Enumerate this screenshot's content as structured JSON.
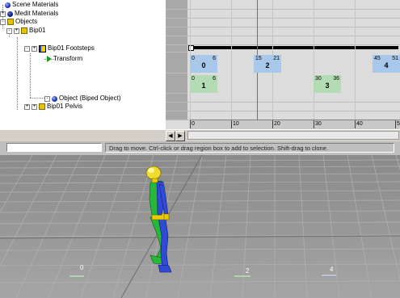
{
  "tree": {
    "items": [
      {
        "label": "Scene Materials"
      },
      {
        "label": "Medit Materials"
      },
      {
        "label": "Objects"
      },
      {
        "label": "Bip01"
      },
      {
        "label": "Bip01 Footsteps"
      },
      {
        "label": "Transform"
      },
      {
        "label": "Object (Biped Object)"
      },
      {
        "label": "Bip01 Pelvis"
      }
    ]
  },
  "footsteps": [
    {
      "start": "0",
      "end": "6",
      "number": "0",
      "color": "blue"
    },
    {
      "start": "15",
      "end": "21",
      "number": "2",
      "color": "blue"
    },
    {
      "start": "45",
      "end": "51",
      "number": "4",
      "color": "blue"
    },
    {
      "start": "0",
      "end": "6",
      "number": "1",
      "color": "green"
    },
    {
      "start": "30",
      "end": "36",
      "number": "3",
      "color": "green"
    }
  ],
  "ruler": {
    "ticks": [
      "0",
      "10",
      "20",
      "30",
      "40",
      "5"
    ]
  },
  "scroll": {
    "left_arrow": "◀",
    "right_arrow": "▶"
  },
  "status": {
    "input_value": "",
    "prompt": "Drag to move. Ctrl-click or drag region box to add to selection. Shift-drag to clone."
  },
  "viewport": {
    "footstep_markers": [
      "0",
      "2",
      "4"
    ]
  },
  "colors": {
    "left_foot": "#2f4bd6",
    "right_foot": "#27b83a",
    "grid": "#9c9c9c"
  }
}
